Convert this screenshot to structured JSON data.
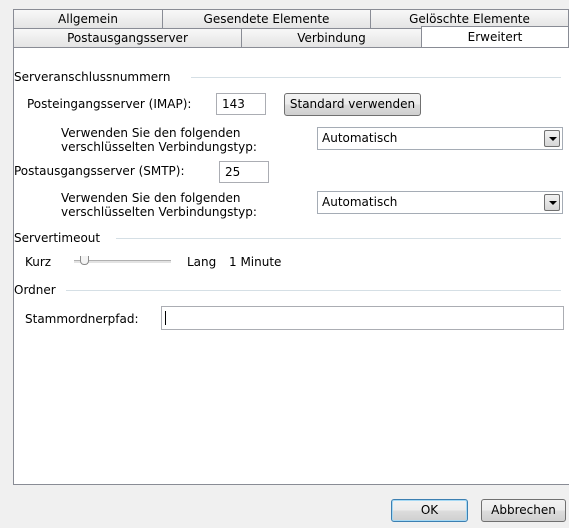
{
  "tabs": {
    "back_row": [
      "Allgemein",
      "Gesendete Elemente",
      "Gelöschte Elemente"
    ],
    "front_row": [
      "Postausgangsserver",
      "Verbindung",
      "Erweitert"
    ],
    "active": "Erweitert"
  },
  "server_ports": {
    "group_title": "Serveranschlussnummern",
    "imap_label": "Posteingangsserver (IMAP):",
    "imap_port": "143",
    "default_button": "Standard verwenden",
    "imap_encryption_label_line1": "Verwenden Sie den folgenden",
    "imap_encryption_label_line2": "verschlüsselten Verbindungstyp:",
    "imap_encryption_value": "Automatisch",
    "smtp_label": "Postausgangsserver (SMTP):",
    "smtp_port": "25",
    "smtp_encryption_label_line1": "Verwenden Sie den folgenden",
    "smtp_encryption_label_line2": "verschlüsselten Verbindungstyp:",
    "smtp_encryption_value": "Automatisch"
  },
  "timeout": {
    "group_title": "Servertimeout",
    "short_label": "Kurz",
    "long_label": "Lang",
    "value_text": "1 Minute",
    "slider_position": 0.1
  },
  "folders": {
    "group_title": "Ordner",
    "root_path_label": "Stammordnerpfad:",
    "root_path_value": ""
  },
  "footer": {
    "ok_label": "OK",
    "cancel_label": "Abbrechen"
  }
}
